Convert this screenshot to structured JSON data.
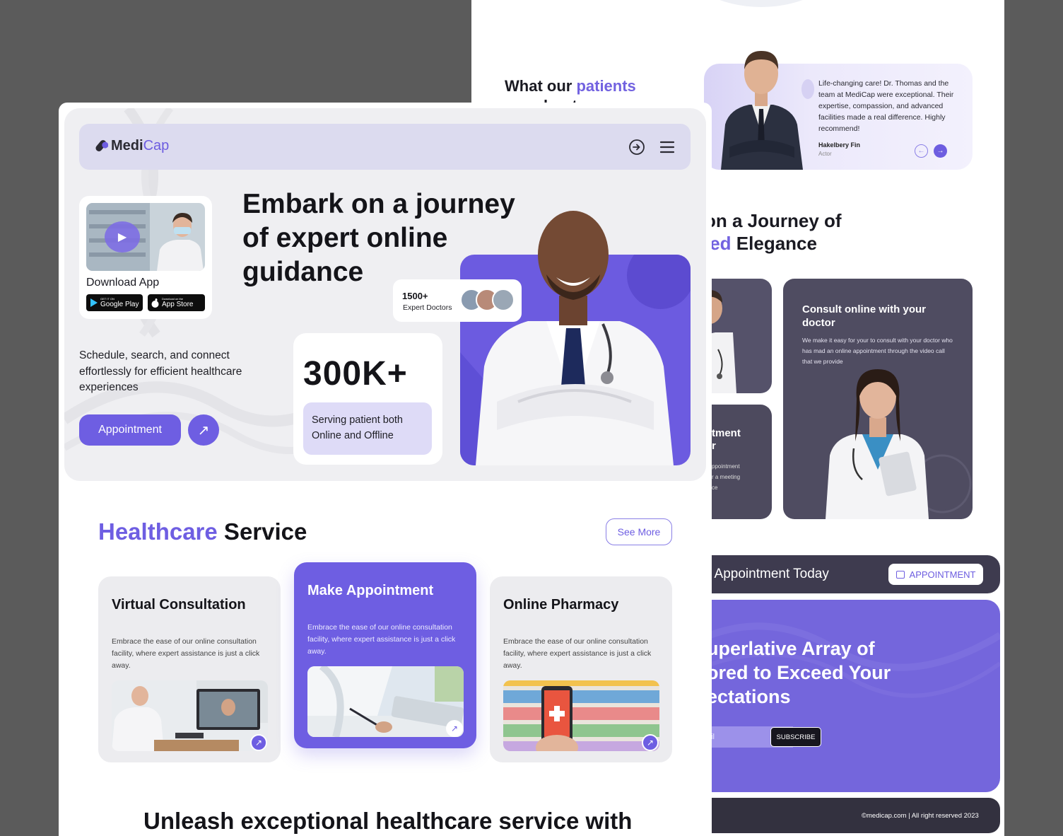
{
  "back_page": {
    "testimonial_section": {
      "title_prefix": "What our ",
      "title_accent": "patients",
      "title_line2": "say about us"
    },
    "testimonial": {
      "quote": "Life-changing care! Dr. Thomas and the team at MediCap were exceptional. Their expertise, compassion, and advanced facilities made a real difference. Highly recommend!",
      "name": "Hakelbery Fin",
      "role": "Actor",
      "prev_icon": "←",
      "next_icon": "→"
    },
    "journey": {
      "line1": "on a Journey of",
      "line2_accent": "led",
      "line2_rest": " Elegance"
    },
    "cards": {
      "card2_title": "tment\nr",
      "card2_text": "ppointment\nr a meeting\nce",
      "card3_title": "Consult online with your doctor",
      "card3_text": "We make it easy for your to consult with your doctor who has mad an online appointment through the video call that we provide"
    },
    "appointment_bar": {
      "text": "r Appointment Today",
      "button": "APPOINTMENT"
    },
    "promo": {
      "line1": "uperlative Array of",
      "line2": "ored to Exceed Your",
      "line3": "ectations",
      "email_placeholder": "ail",
      "subscribe": "SUBSCRIBE"
    },
    "footer": "©medicap.com | All right reserved 2023"
  },
  "front_page": {
    "nav": {
      "logo_medi": "Medi",
      "logo_cap": "Cap"
    },
    "app_card": {
      "title": "Download App",
      "google_small": "GET IT ON",
      "google_big": "Google Play",
      "apple_small": "Download on the",
      "apple_big": "App Store"
    },
    "hero": {
      "title": "Embark on a journey of expert online guidance",
      "description": "Schedule, search, and connect effortlessly for efficient healthcare experiences",
      "button": "Appointment",
      "arrow": "↗"
    },
    "experts": {
      "count": "1500+",
      "label": "Expert Doctors"
    },
    "stat": {
      "value": "300K+",
      "label": "Serving patient both Online and Offline"
    },
    "services": {
      "title_accent": "Healthcare",
      "title_rest": " Service",
      "see_more": "See More",
      "items": [
        {
          "title": "Virtual Consultation",
          "text": "Embrace the ease of our online consultation facility, where expert assistance is just a click away.",
          "arrow": "↗"
        },
        {
          "title": "Make Appointment",
          "text": "Embrace the ease of our online consultation facility, where expert assistance is just a click away.",
          "arrow": "↗"
        },
        {
          "title": "Online Pharmacy",
          "text": "Embrace the ease of our online consultation facility, where expert assistance is just a click away.",
          "arrow": "↗"
        }
      ]
    },
    "bottom_title": "Unleash exceptional healthcare service with"
  },
  "colors": {
    "accent": "#6e5ee2",
    "accent_light": "#dedbf7",
    "dark_card": "#4d4a5e",
    "background": "#5b5b5b"
  }
}
